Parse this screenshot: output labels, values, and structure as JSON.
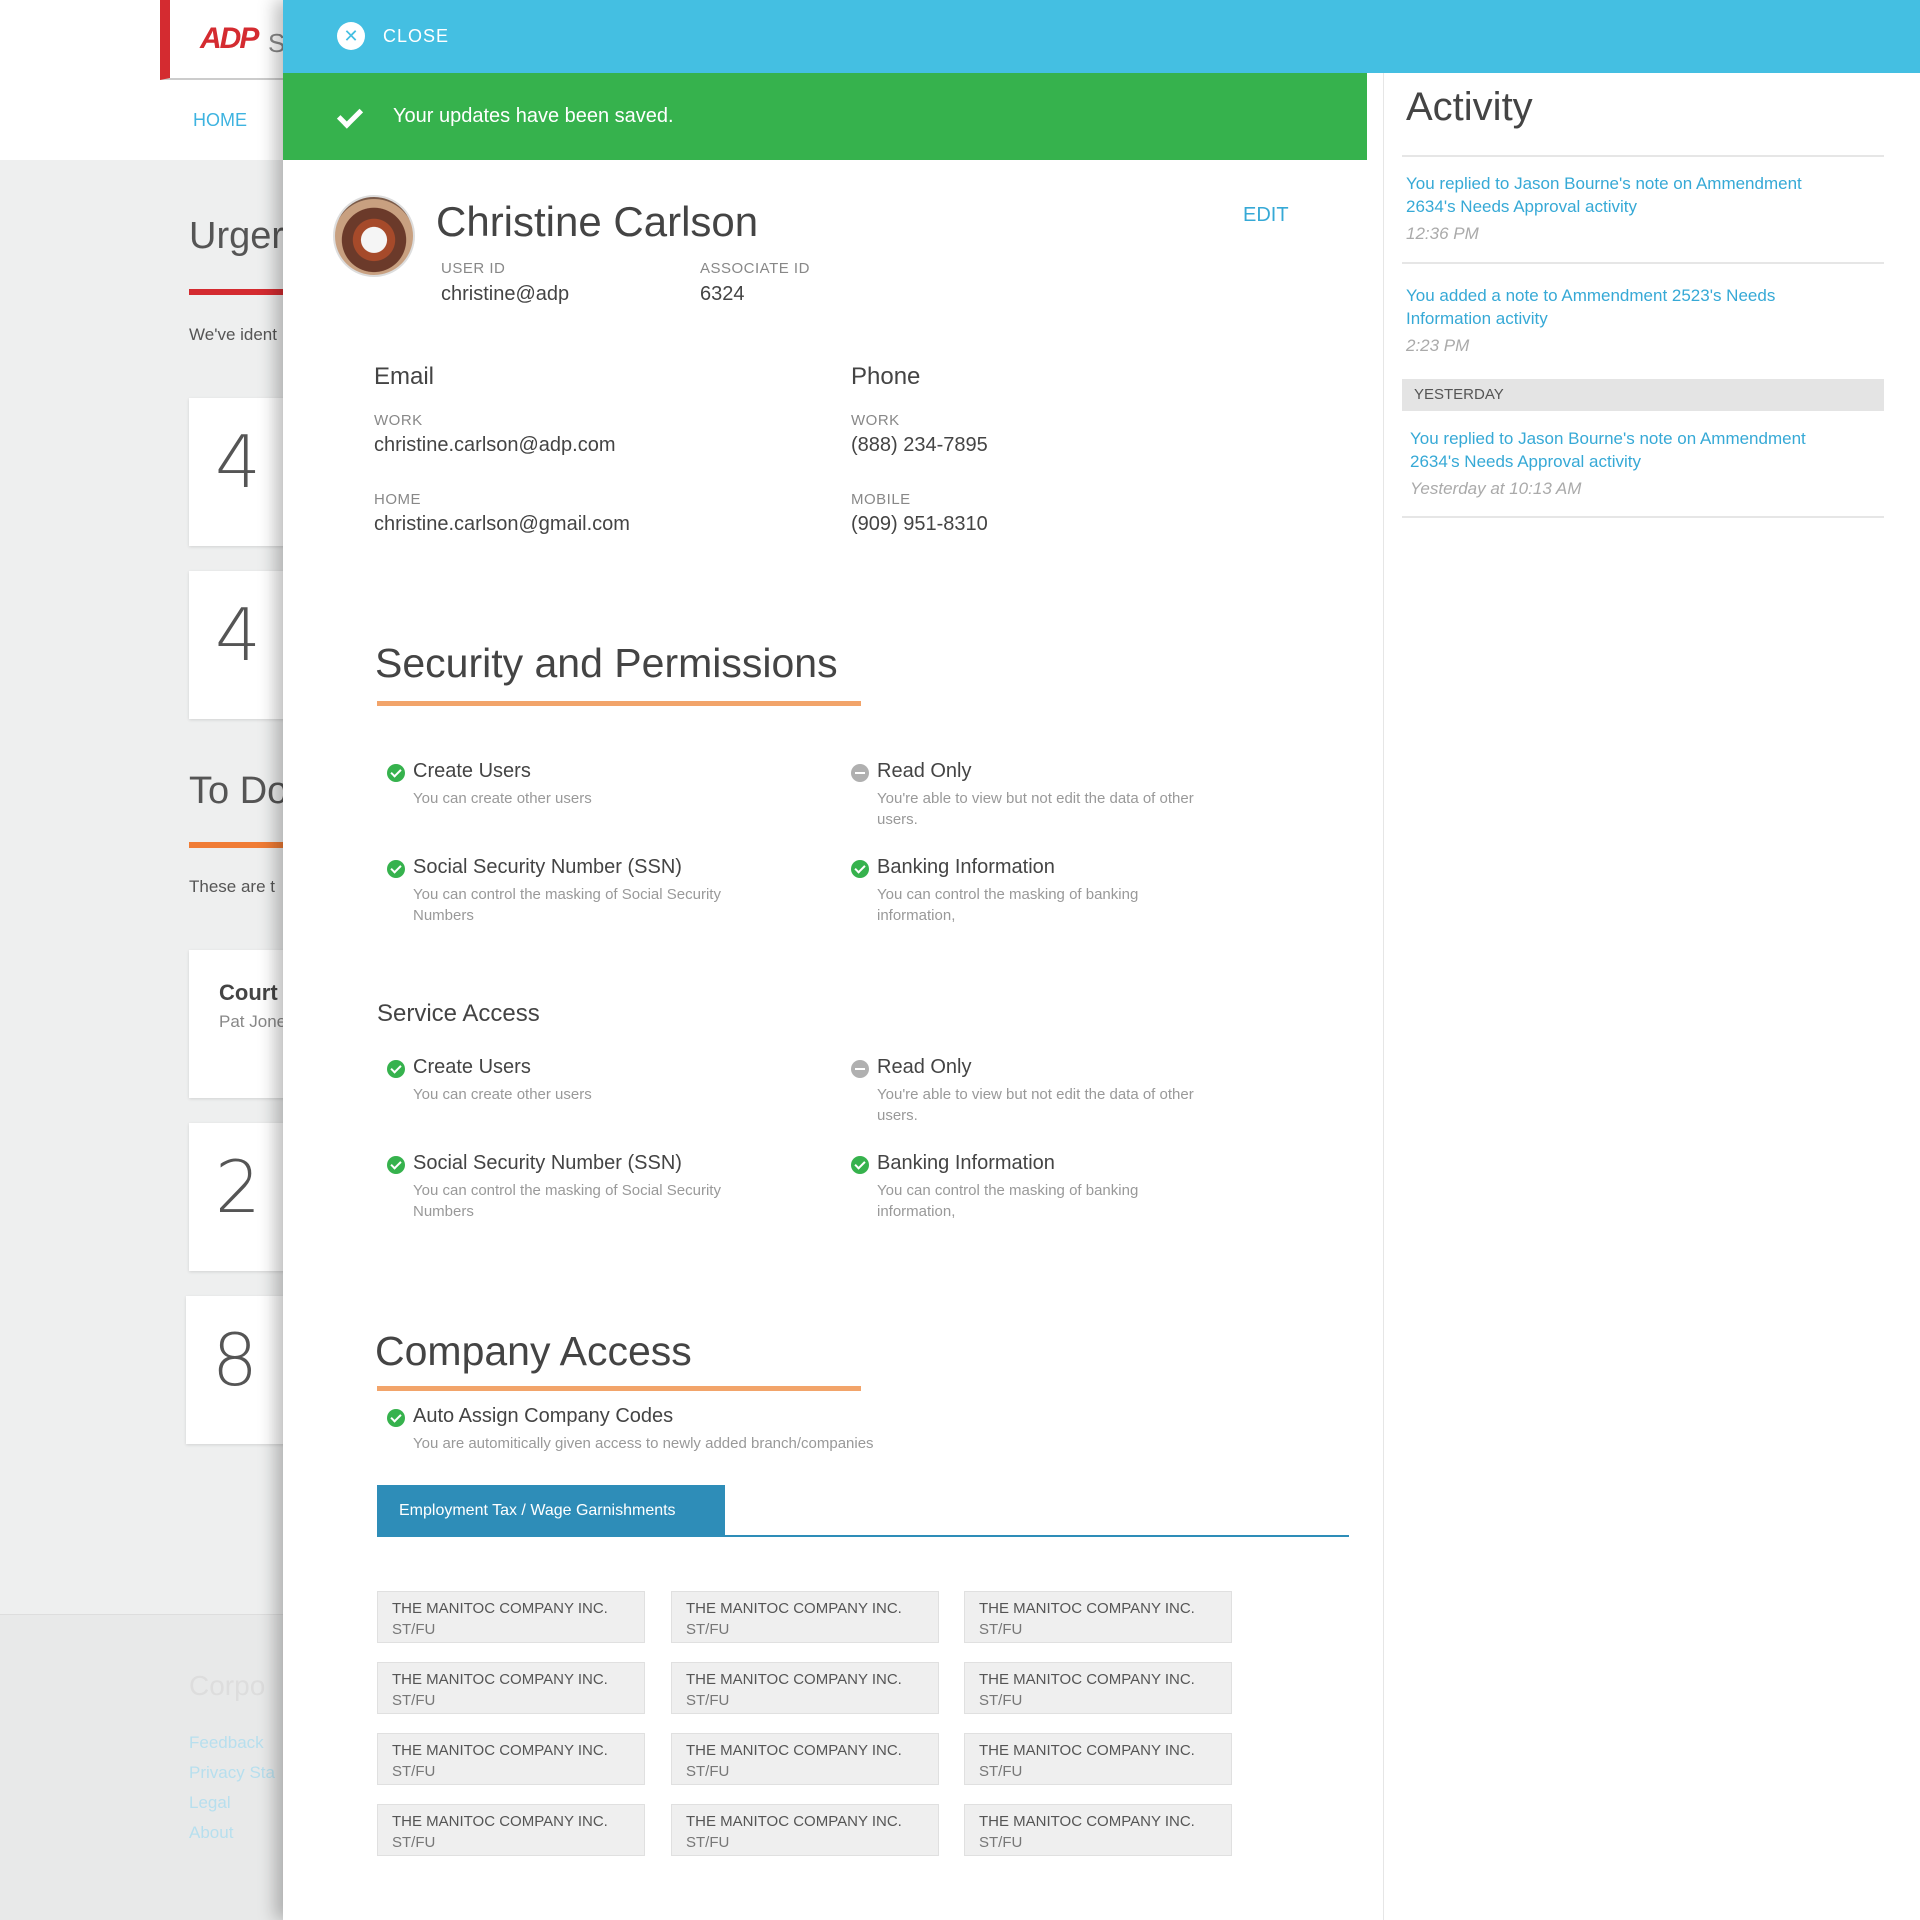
{
  "background": {
    "logo": "ADP",
    "logo_suffix": "S",
    "nav_home": "HOME",
    "urgent_title": "Urger",
    "urgent_text": "We've ident",
    "cards": [
      "4",
      "4"
    ],
    "todo_title": "To Do",
    "todo_text": "These are t",
    "task_title": "Court",
    "task_sub": "Pat Jone",
    "numbers": [
      "2",
      "8"
    ],
    "footer_title": "Corpo",
    "footer_links": [
      "Feedback",
      "Privacy Sta",
      "Legal",
      "About"
    ],
    "colors": {
      "red_accent": "#d42b30",
      "orange_accent": "#f07c35"
    }
  },
  "topbar": {
    "close_label": "CLOSE",
    "close_icon": "x",
    "color": "#44bfe2"
  },
  "success": {
    "message": "Your updates have been saved.",
    "color": "#36b24d"
  },
  "user": {
    "name": "Christine Carlson",
    "edit_label": "EDIT",
    "user_id_label": "USER ID",
    "user_id": "christine@adp",
    "associate_id_label": "ASSOCIATE ID",
    "associate_id": "6324"
  },
  "contact": {
    "email_title": "Email",
    "email_work_label": "WORK",
    "email_work": "christine.carlson@adp.com",
    "email_home_label": "HOME",
    "email_home": "christine.carlson@gmail.com",
    "phone_title": "Phone",
    "phone_work_label": "WORK",
    "phone_work": "(888) 234-7895",
    "phone_mobile_label": "MOBILE",
    "phone_mobile": "(909) 951-8310"
  },
  "security": {
    "title": "Security and Permissions",
    "permissions": [
      {
        "title": "Create Users",
        "desc": "You can create other users",
        "status": "granted"
      },
      {
        "title": "Read Only",
        "desc": "You're able to view but not edit the data of other users.",
        "status": "limited"
      },
      {
        "title": "Social Security Number (SSN)",
        "desc": "You can control the masking of Social Security Numbers",
        "status": "granted"
      },
      {
        "title": "Banking Information",
        "desc": "You can control the masking of banking information,",
        "status": "granted"
      }
    ]
  },
  "service": {
    "title": "Service Access",
    "permissions": [
      {
        "title": "Create Users",
        "desc": "You can create other users",
        "status": "granted"
      },
      {
        "title": "Read Only",
        "desc": "You're able to view but not edit the data of other users.",
        "status": "limited"
      },
      {
        "title": "Social Security Number (SSN)",
        "desc": "You can control the masking of Social Security Numbers",
        "status": "granted"
      },
      {
        "title": "Banking Information",
        "desc": "You can control the masking of banking information,",
        "status": "granted"
      }
    ]
  },
  "company": {
    "title": "Company Access",
    "auto_assign_title": "Auto Assign Company Codes",
    "auto_assign_desc": "You are automitically given access to newly added branch/companies",
    "tab_label": "Employment Tax / Wage Garnishments",
    "companies": [
      {
        "name": "THE MANITOC COMPANY INC.",
        "code": "ST/FU"
      },
      {
        "name": "THE MANITOC COMPANY INC.",
        "code": "ST/FU"
      },
      {
        "name": "THE MANITOC COMPANY INC.",
        "code": "ST/FU"
      },
      {
        "name": "THE MANITOC COMPANY INC.",
        "code": "ST/FU"
      },
      {
        "name": "THE MANITOC COMPANY INC.",
        "code": "ST/FU"
      },
      {
        "name": "THE MANITOC COMPANY INC.",
        "code": "ST/FU"
      },
      {
        "name": "THE MANITOC COMPANY INC.",
        "code": "ST/FU"
      },
      {
        "name": "THE MANITOC COMPANY INC.",
        "code": "ST/FU"
      },
      {
        "name": "THE MANITOC COMPANY INC.",
        "code": "ST/FU"
      },
      {
        "name": "THE MANITOC COMPANY INC.",
        "code": "ST/FU"
      },
      {
        "name": "THE MANITOC COMPANY INC.",
        "code": "ST/FU"
      },
      {
        "name": "THE MANITOC COMPANY INC.",
        "code": "ST/FU"
      }
    ]
  },
  "activity": {
    "title": "Activity",
    "yesterday_label": "YESTERDAY",
    "items": [
      {
        "text": "You replied to Jason Bourne's note on Ammendment 2634's Needs Approval activity",
        "time": "12:36 PM"
      },
      {
        "text": "You added a note to Ammendment 2523's Needs Information activity",
        "time": "2:23 PM"
      },
      {
        "text": "You replied to Jason Bourne's note on Ammendment 2634's Needs Approval activity",
        "time": "Yesterday at 10:13 AM"
      }
    ]
  }
}
